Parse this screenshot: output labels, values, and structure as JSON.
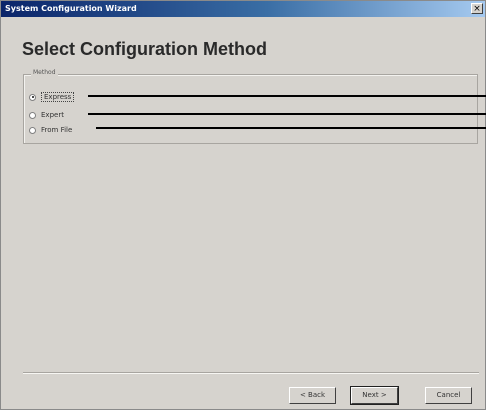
{
  "window": {
    "title": "System Configuration Wizard",
    "close_glyph": "×"
  },
  "heading": "Select Configuration Method",
  "method_group": {
    "label": "Method",
    "options": [
      {
        "label": "Express",
        "selected": true
      },
      {
        "label": "Expert",
        "selected": false
      },
      {
        "label": "From File",
        "selected": false
      }
    ]
  },
  "buttons": {
    "back": "< Back",
    "next": "Next >",
    "cancel": "Cancel"
  },
  "icons": {
    "close": "close-icon"
  }
}
